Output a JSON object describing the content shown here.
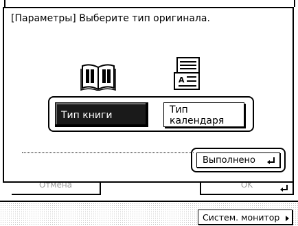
{
  "background": {
    "cancel_label": "Отмена",
    "ok_label": "OK"
  },
  "dialog": {
    "title": "[Параметры] Выберите тип оригинала.",
    "options": [
      {
        "label": "Тип книги",
        "selected": true,
        "icon": "open-book-icon"
      },
      {
        "label": "Тип\nкалендаря",
        "selected": false,
        "icon": "calendar-document-icon"
      }
    ],
    "done_label": "Выполнено"
  },
  "footer": {
    "monitor_label": "Систем. монитор"
  }
}
